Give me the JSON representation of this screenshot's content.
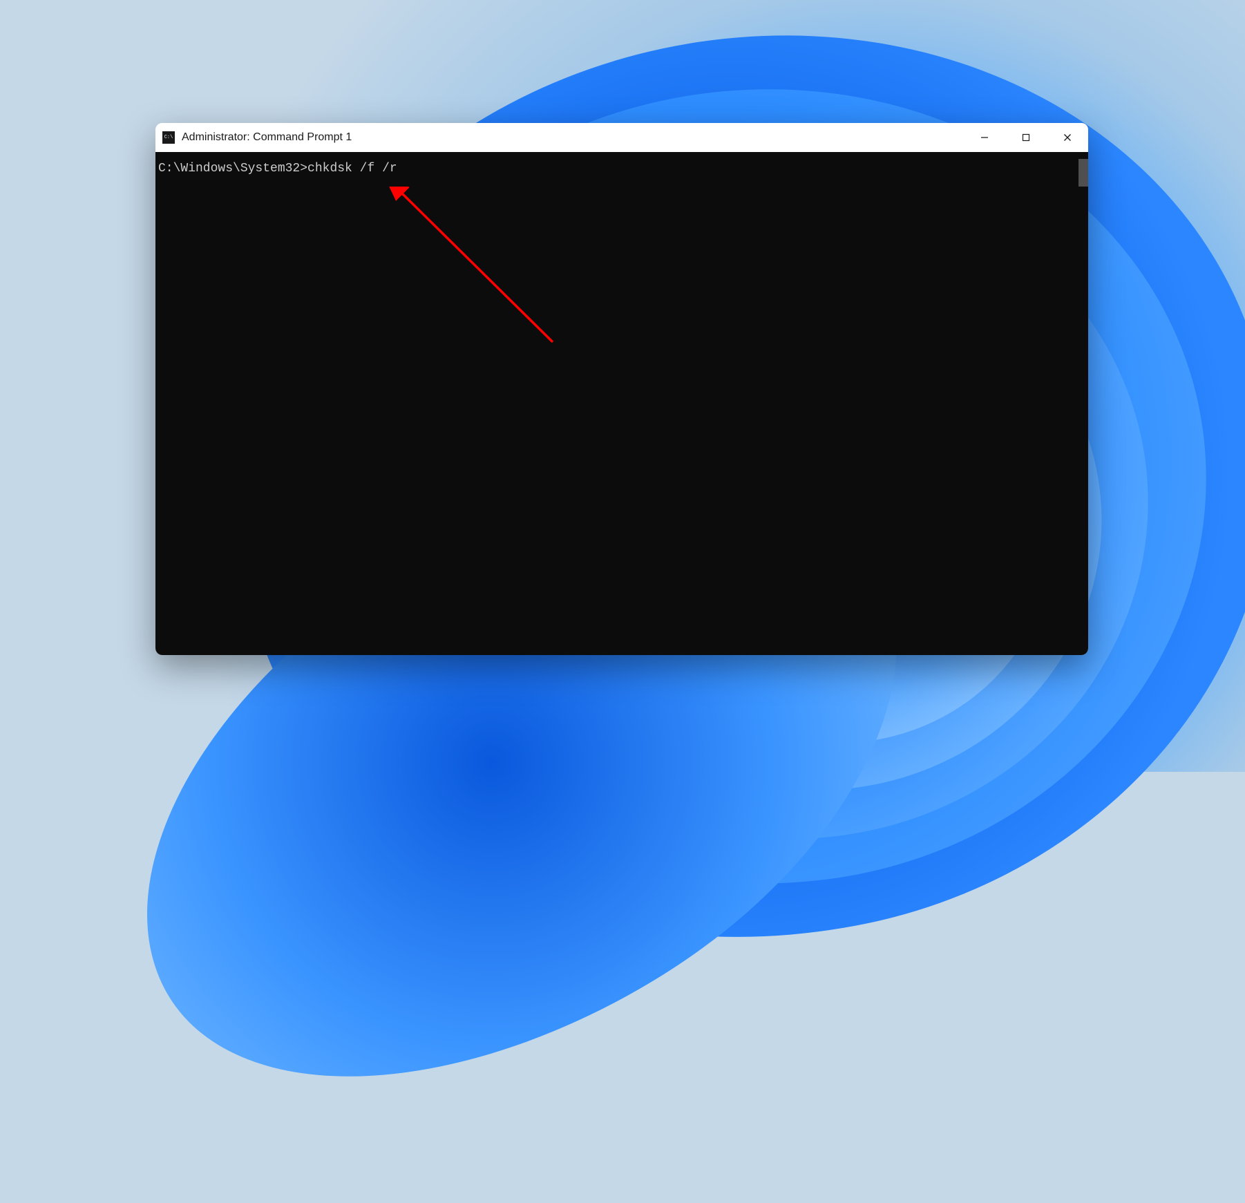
{
  "window": {
    "title": "Administrator: Command Prompt 1"
  },
  "terminal": {
    "prompt": "C:\\Windows\\System32>",
    "command": "chkdsk /f /r"
  }
}
